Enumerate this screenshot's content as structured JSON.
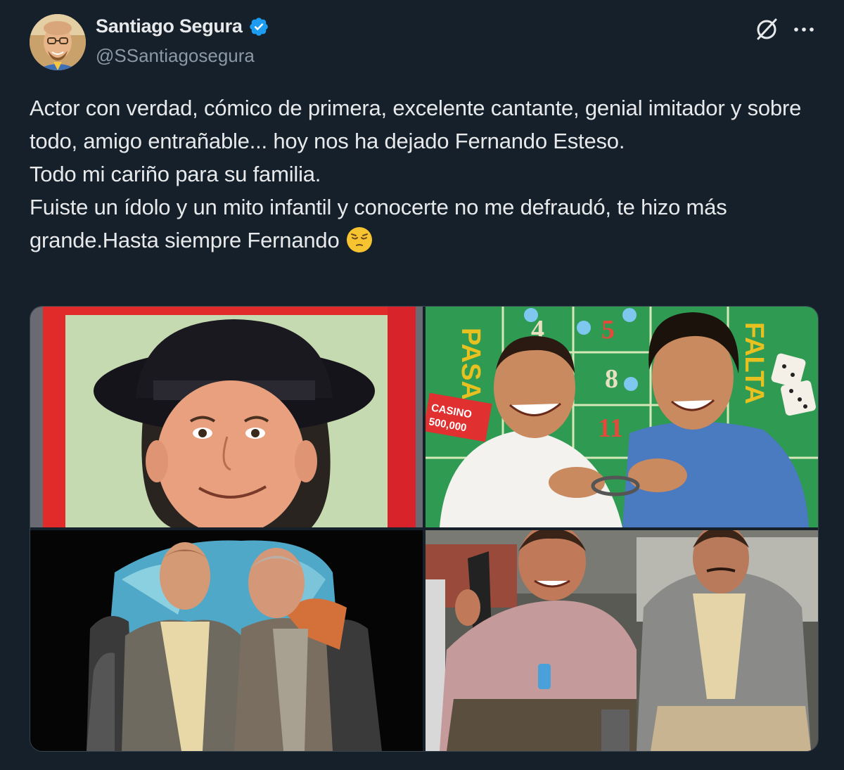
{
  "author": {
    "display_name": "Santiago Segura",
    "handle": "@SSantiagosegura",
    "verified": true,
    "avatar_icon": "avatar-photo"
  },
  "actions": {
    "grok_icon": "grok-icon",
    "more_icon": "more-icon"
  },
  "tweet": {
    "lines": [
      "Actor con verdad, cómico de primera, excelente cantante, genial imitador y sobre todo, amigo entrañable... hoy nos ha dejado Fernando Esteso.",
      "Todo mi cariño para su familia.",
      "Fuiste un ídolo y un mito infantil y conocerte no me defraudó, te hizo más grande.Hasta siempre Fernando"
    ],
    "emoji": "pensive-face-emoji"
  },
  "media": {
    "photos": [
      {
        "name": "photo-man-black-hat"
      },
      {
        "name": "photo-two-men-handcuffed-casino",
        "texts": {
          "pasa": "PASA",
          "falta": "FALTA",
          "casino": "CASINO",
          "amount": "500,000",
          "n4": "4",
          "n5": "5",
          "n8": "8",
          "n11": "11"
        }
      },
      {
        "name": "photo-two-men-cave"
      },
      {
        "name": "photo-two-men-seated"
      }
    ]
  },
  "colors": {
    "background": "#15202b",
    "text": "#e7e9ea",
    "secondary": "#8b98a5",
    "verified": "#1d9bf0",
    "border": "#38444d"
  }
}
